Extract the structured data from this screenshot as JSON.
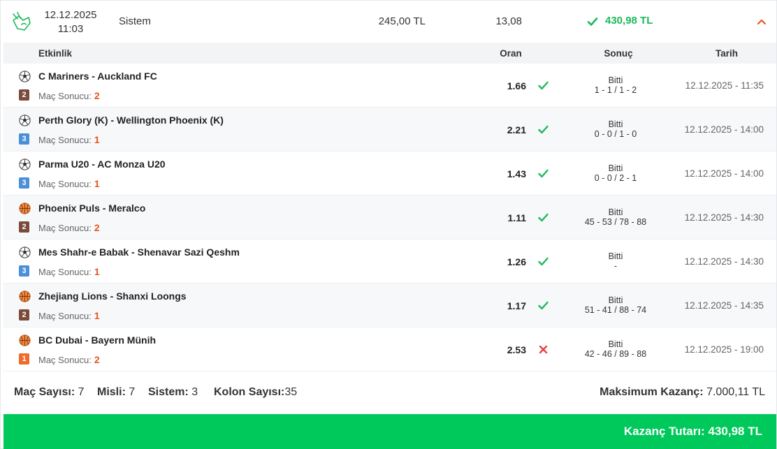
{
  "summary": {
    "date": "12.12.2025",
    "time": "11:03",
    "type": "Sistem",
    "stake": "245,00 TL",
    "total_odds": "13,08",
    "won_amount": "430,98 TL",
    "status_icon": "check-icon",
    "toggle_icon": "chevron-up-icon"
  },
  "columns": {
    "event": "Etkinlik",
    "odds": "Oran",
    "result": "Sonuç",
    "date": "Tarih"
  },
  "rows": [
    {
      "sport": "football",
      "match": "C Mariners - Auckland FC",
      "seq": "2",
      "seq_color": "#7a4b3a",
      "market": "Maç Sonucu:",
      "pick": "2",
      "odds": "1.66",
      "status": "won",
      "result_status": "Bitti",
      "score": "1 - 1 / 1 - 2",
      "date": "12.12.2025 - 11:35"
    },
    {
      "sport": "football",
      "match": "Perth Glory (K) - Wellington Phoenix (K)",
      "seq": "3",
      "seq_color": "#4a90d9",
      "market": "Maç Sonucu:",
      "pick": "1",
      "odds": "2.21",
      "status": "won",
      "result_status": "Bitti",
      "score": "0 - 0 / 1 - 0",
      "date": "12.12.2025 - 14:00"
    },
    {
      "sport": "football",
      "match": "Parma U20 - AC Monza U20",
      "seq": "3",
      "seq_color": "#4a90d9",
      "market": "Maç Sonucu:",
      "pick": "1",
      "odds": "1.43",
      "status": "won",
      "result_status": "Bitti",
      "score": "0 - 0 / 2 - 1",
      "date": "12.12.2025 - 14:00"
    },
    {
      "sport": "basketball",
      "match": "Phoenix Puls - Meralco",
      "seq": "2",
      "seq_color": "#7a4b3a",
      "market": "Maç Sonucu:",
      "pick": "2",
      "odds": "1.11",
      "status": "won",
      "result_status": "Bitti",
      "score": "45 - 53 / 78 - 88",
      "date": "12.12.2025 - 14:30"
    },
    {
      "sport": "football",
      "match": "Mes Shahr-e Babak - Shenavar Sazi Qeshm",
      "seq": "3",
      "seq_color": "#4a90d9",
      "market": "Maç Sonucu:",
      "pick": "1",
      "odds": "1.26",
      "status": "won",
      "result_status": "Bitti",
      "score": "-",
      "date": "12.12.2025 - 14:30"
    },
    {
      "sport": "basketball",
      "match": "Zhejiang Lions - Shanxi Loongs",
      "seq": "2",
      "seq_color": "#7a4b3a",
      "market": "Maç Sonucu:",
      "pick": "1",
      "odds": "1.17",
      "status": "won",
      "result_status": "Bitti",
      "score": "51 - 41 / 88 - 74",
      "date": "12.12.2025 - 14:35"
    },
    {
      "sport": "basketball",
      "match": "BC Dubai - Bayern Münih",
      "seq": "1",
      "seq_color": "#f06a2a",
      "market": "Maç Sonucu:",
      "pick": "2",
      "odds": "2.53",
      "status": "lost",
      "result_status": "Bitti",
      "score": "42 - 46 / 89 - 88",
      "date": "12.12.2025 - 19:00"
    }
  ],
  "stats": {
    "match_count_label": "Maç Sayısı:",
    "match_count": "7",
    "misli_label": "Misli:",
    "misli": "7",
    "system_label": "Sistem:",
    "system": "3",
    "column_count_label": "Kolon Sayısı:",
    "column_count": "35",
    "max_win_label": "Maksimum Kazanç:",
    "max_win": "7.000,11 TL"
  },
  "payout": {
    "label": "Kazanç Tutarı:",
    "amount": "430,98 TL"
  },
  "colors": {
    "won": "#1cb95a",
    "lost": "#e8403a",
    "accent": "#e4571e",
    "payout_bg": "#00c95b"
  }
}
